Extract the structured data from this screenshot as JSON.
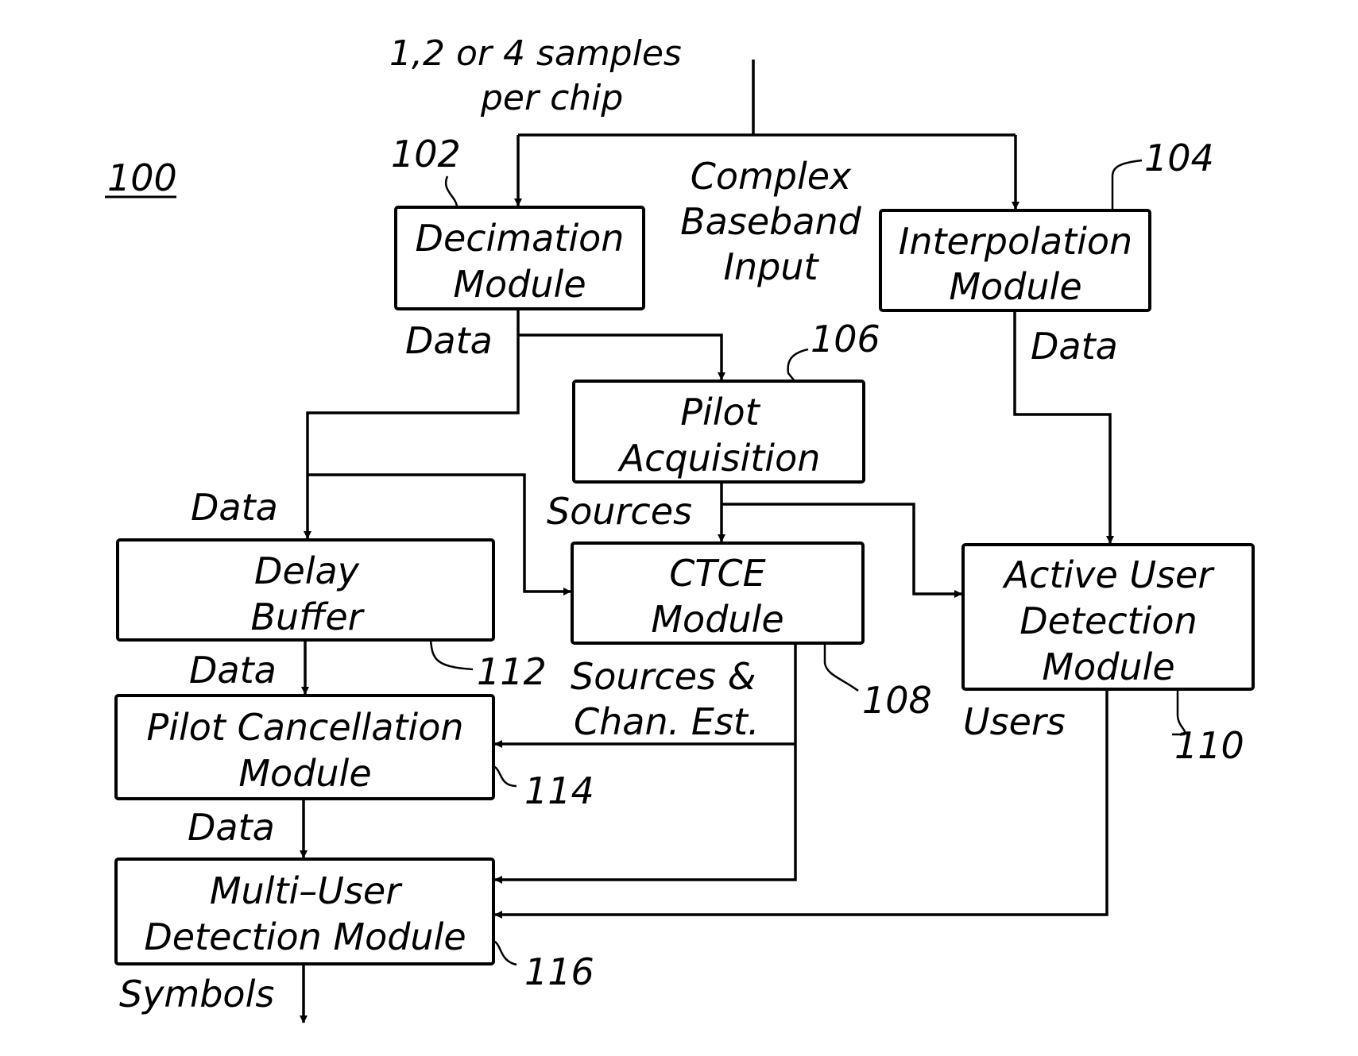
{
  "figure": {
    "reference": "100",
    "input_note": [
      "1,2 or 4 samples",
      "per chip"
    ],
    "input_label": [
      "Complex",
      "Baseband",
      "Input"
    ]
  },
  "blocks": {
    "decimation": {
      "ref": "102",
      "lines": [
        "Decimation",
        "Module"
      ]
    },
    "interpolation": {
      "ref": "104",
      "lines": [
        "Interpolation",
        "Module"
      ]
    },
    "pilot_acquisition": {
      "ref": "106",
      "lines": [
        "Pilot",
        "Acquisition"
      ]
    },
    "ctce": {
      "ref": "108",
      "lines": [
        "CTCE",
        "Module"
      ]
    },
    "active_user_detection": {
      "ref": "110",
      "lines": [
        "Active  User",
        "Detection",
        "Module"
      ]
    },
    "delay_buffer": {
      "ref": "112",
      "lines": [
        "Delay",
        "Buffer"
      ]
    },
    "pilot_cancellation": {
      "ref": "114",
      "lines": [
        "Pilot  Cancellation",
        "Module"
      ]
    },
    "multi_user_detection": {
      "ref": "116",
      "lines": [
        "Multi–User",
        "Detection  Module"
      ]
    }
  },
  "signals": {
    "decimation_data": "Data",
    "interpolation_data": "Data",
    "delay_in_data": "Data",
    "delay_out_data": "Data",
    "pcm_out_data": "Data",
    "sources": "Sources",
    "sources_chan_est": [
      "Sources  &",
      "Chan.  Est."
    ],
    "users": "Users",
    "symbols": "Symbols"
  }
}
